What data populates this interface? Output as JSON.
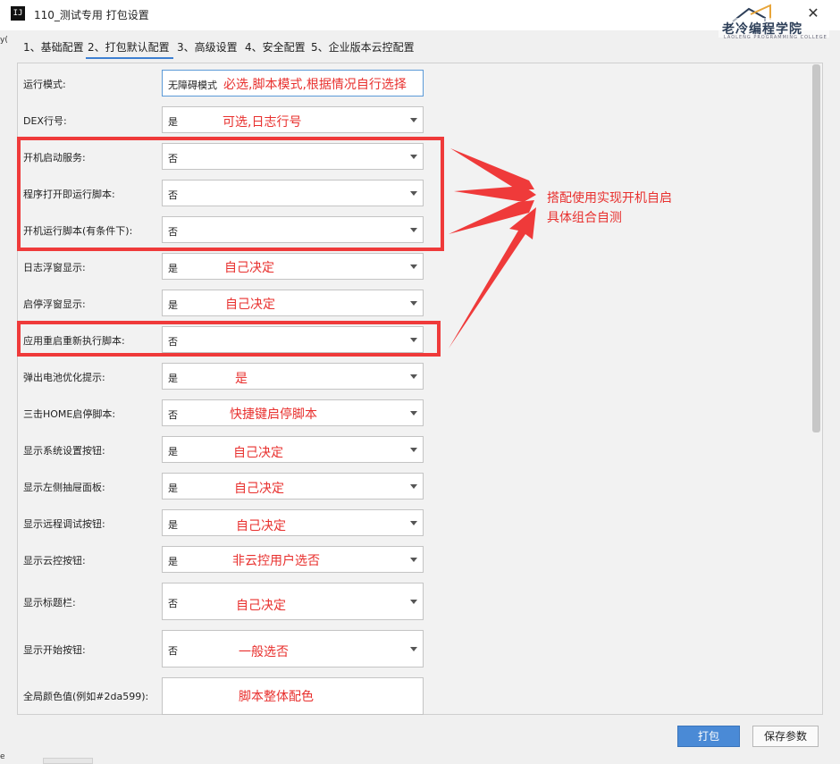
{
  "window": {
    "title": "110_测试专用 打包设置",
    "app_icon": "IJ",
    "close_glyph": "✕",
    "logo": "老冷编程学院",
    "logo_sub": "LAOLENG PROGRAMMING COLLEGE",
    "left_edge_text": "y(",
    "bottom_edge_text": "e"
  },
  "tabs": [
    {
      "label": "1、基础配置"
    },
    {
      "label": "2、打包默认配置"
    },
    {
      "label": "3、高级设置"
    },
    {
      "label": "4、安全配置"
    },
    {
      "label": "5、企业版本云控配置"
    }
  ],
  "rows": [
    {
      "label": "运行模式:",
      "value": "无障碍模式"
    },
    {
      "label": "DEX行号:",
      "value": "是"
    },
    {
      "label": "开机启动服务:",
      "value": "否"
    },
    {
      "label": "程序打开即运行脚本:",
      "value": "否"
    },
    {
      "label": "开机运行脚本(有条件下):",
      "value": "否"
    },
    {
      "label": "日志浮窗显示:",
      "value": "是"
    },
    {
      "label": "启停浮窗显示:",
      "value": "是"
    },
    {
      "label": "应用重启重新执行脚本:",
      "value": "否"
    },
    {
      "label": "弹出电池优化提示:",
      "value": "是"
    },
    {
      "label": "三击HOME启停脚本:",
      "value": "否"
    },
    {
      "label": "显示系统设置按钮:",
      "value": "是"
    },
    {
      "label": "显示左侧抽屉面板:",
      "value": "是"
    },
    {
      "label": "显示远程调试按钮:",
      "value": "是"
    },
    {
      "label": "显示云控按钮:",
      "value": "是"
    },
    {
      "label": "显示标题栏:",
      "value": "否"
    },
    {
      "label": "显示开始按钮:",
      "value": "否"
    },
    {
      "label": "全局颜色值(例如#2da599):",
      "value": ""
    }
  ],
  "annotations": [
    "必选,脚本模式,根据情况自行选择",
    "可选,日志行号",
    "自己决定",
    "自己决定",
    "是",
    "快捷键启停脚本",
    "自己决定",
    "自己决定",
    "自己决定",
    "非云控用户选否",
    "自己决定",
    "一般选否",
    "脚本整体配色"
  ],
  "callout": {
    "line1": "搭配使用实现开机自启",
    "line2": "具体组合自测"
  },
  "buttons": {
    "pack": "打包",
    "save": "保存参数"
  },
  "colors": {
    "annotation_red": "#e8302e",
    "primary_blue": "#4a8ad6"
  }
}
